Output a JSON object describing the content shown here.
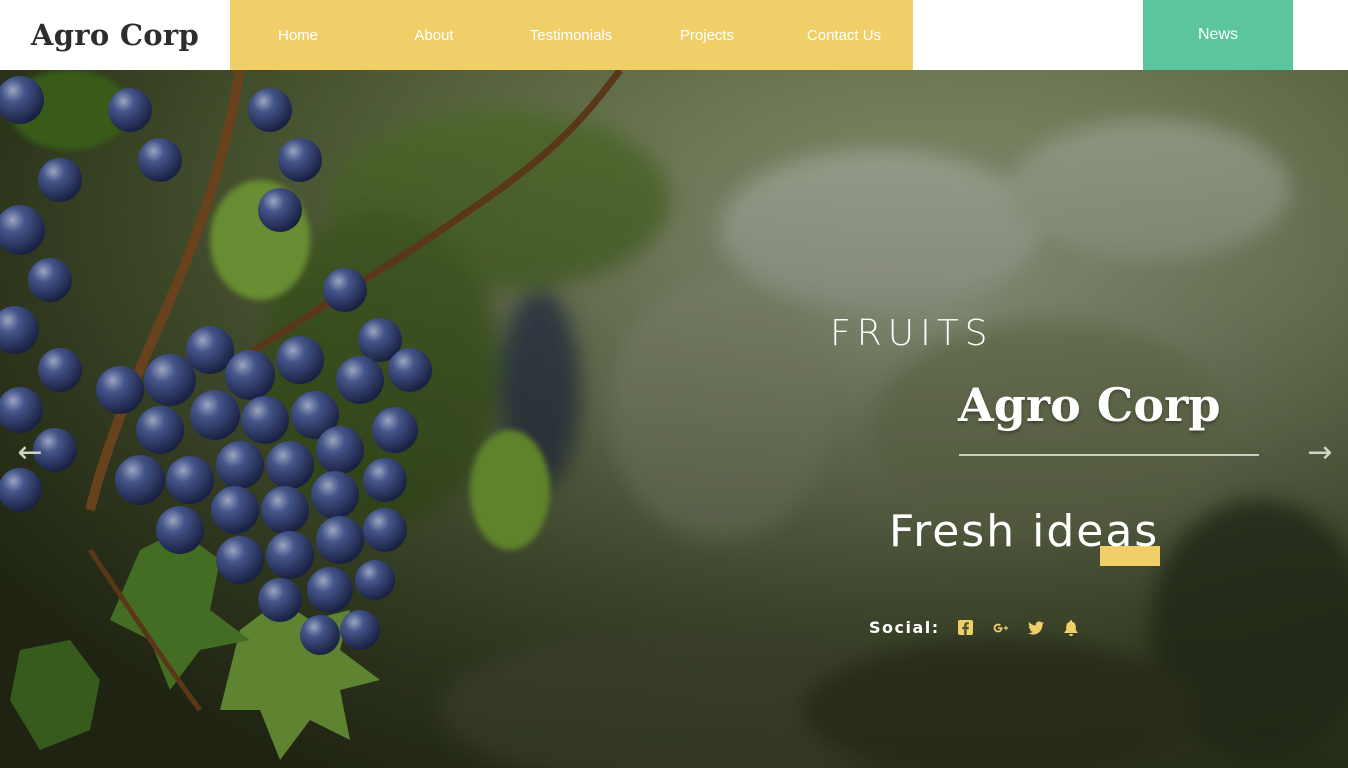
{
  "header": {
    "logo": "Agro Corp",
    "nav": [
      {
        "label": "Home"
      },
      {
        "label": "About"
      },
      {
        "label": "Testimonials"
      },
      {
        "label": "Projects"
      },
      {
        "label": "Contact Us"
      }
    ],
    "news_label": "News"
  },
  "hero": {
    "subtitle": "FRUITS",
    "brand": "Agro Corp",
    "tagline": "Fresh ideas",
    "social_label": "Social:",
    "social_icons": [
      "facebook-icon",
      "google-plus-icon",
      "twitter-icon",
      "bell-icon"
    ],
    "prev_arrow": "←",
    "next_arrow": "→"
  },
  "colors": {
    "nav_bg": "#f0cf69",
    "news_bg": "#5bc59e",
    "accent": "#f0cf69",
    "text_on_hero": "#ffffff"
  }
}
